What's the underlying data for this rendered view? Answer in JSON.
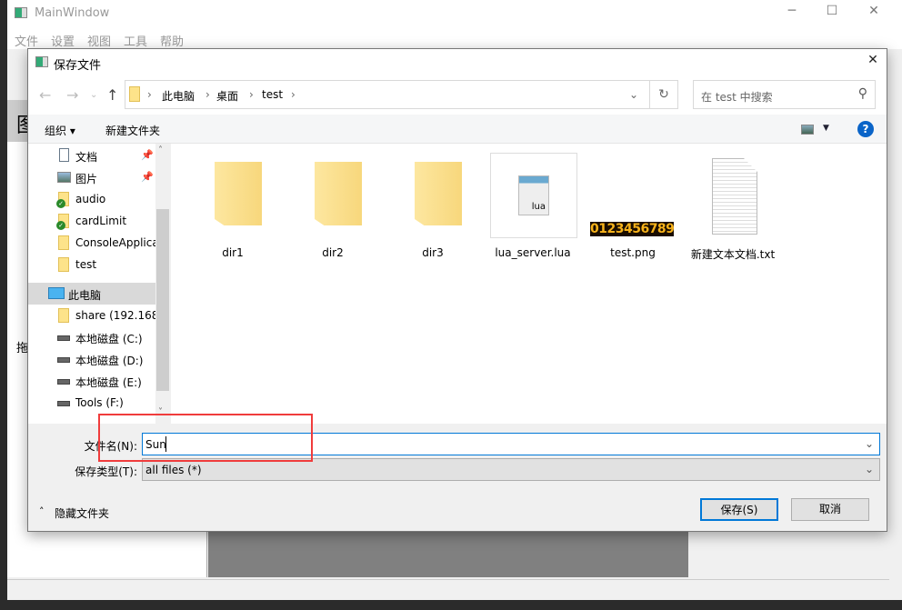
{
  "main_window": {
    "title": "MainWindow",
    "menu": [
      "文件",
      "设置",
      "视图",
      "工具",
      "帮助"
    ],
    "fragments": {
      "header_char": "图",
      "label_char": "拖"
    },
    "window_controls": [
      "minimize",
      "maximize",
      "close"
    ]
  },
  "dialog": {
    "title": "保存文件",
    "breadcrumb": [
      "此电脑",
      "桌面",
      "test"
    ],
    "search_placeholder": "在 test 中搜索",
    "toolbar": {
      "organize": "组织 ▾",
      "new_folder": "新建文件夹",
      "help": "?"
    },
    "sidebar": [
      {
        "label": "文档",
        "icon": "document-icon",
        "pinned": true
      },
      {
        "label": "图片",
        "icon": "picture-icon",
        "pinned": true
      },
      {
        "label": "audio",
        "icon": "synced-folder-icon"
      },
      {
        "label": "cardLimit",
        "icon": "synced-folder-icon"
      },
      {
        "label": "ConsoleApplica",
        "icon": "folder-icon"
      },
      {
        "label": "test",
        "icon": "folder-icon"
      },
      {
        "label": "此电脑",
        "icon": "computer-icon",
        "selected": true
      },
      {
        "label": "share (192.168.",
        "icon": "network-folder-icon"
      },
      {
        "label": "本地磁盘 (C:)",
        "icon": "drive-icon"
      },
      {
        "label": "本地磁盘 (D:)",
        "icon": "drive-icon"
      },
      {
        "label": "本地磁盘 (E:)",
        "icon": "drive-icon"
      },
      {
        "label": "Tools (F:)",
        "icon": "drive-icon"
      }
    ],
    "files": [
      {
        "name": "dir1",
        "type": "folder"
      },
      {
        "name": "dir2",
        "type": "folder"
      },
      {
        "name": "dir3",
        "type": "folder"
      },
      {
        "name": "lua_server.lua",
        "type": "lua",
        "icon_text": "lua"
      },
      {
        "name": "test.png",
        "type": "image",
        "thumb_text": "0123456789"
      },
      {
        "name": "新建文本文档.txt",
        "type": "text"
      }
    ],
    "filename_label": "文件名(N):",
    "filename_value": "Sun",
    "filetype_label": "保存类型(T):",
    "filetype_value": "all files (*)",
    "hide_folders": "隐藏文件夹",
    "save": "保存(S)",
    "cancel": "取消"
  },
  "colors": {
    "accent": "#0078d7",
    "highlight_box": "#f03c3c"
  }
}
